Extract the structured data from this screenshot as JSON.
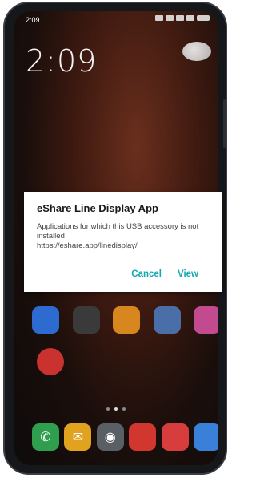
{
  "status": {
    "time": "2:09"
  },
  "lockscreen": {
    "clock": "2:09"
  },
  "dialog": {
    "title": "eShare Line Display App",
    "message": "Applications for which this USB accessory is not installed",
    "url": "https://eshare.app/linedisplay/",
    "cancel_label": "Cancel",
    "view_label": "View",
    "accent": "#12a9b0"
  },
  "apps": {
    "row1": [
      {
        "icon": "app-icon",
        "color": "#2e6bd0"
      },
      {
        "icon": "app-icon",
        "color": "#3a3a3a"
      },
      {
        "icon": "app-icon",
        "color": "#d8871f"
      },
      {
        "icon": "app-icon",
        "color": "#4a6fa8"
      },
      {
        "icon": "app-icon",
        "color": "#c24a8f"
      }
    ],
    "single": {
      "icon": "app-icon",
      "color": "#c9322f"
    },
    "dock": [
      {
        "icon": "phone-icon",
        "color": "#2f9e4f"
      },
      {
        "icon": "messages-icon",
        "color": "#e0a21f"
      },
      {
        "icon": "camera-icon",
        "color": "#5a5f66"
      },
      {
        "icon": "app-icon",
        "color": "#d2372f"
      },
      {
        "icon": "app-icon",
        "color": "#d83d3d"
      },
      {
        "icon": "app-icon",
        "color": "#3a7fd8"
      }
    ]
  }
}
